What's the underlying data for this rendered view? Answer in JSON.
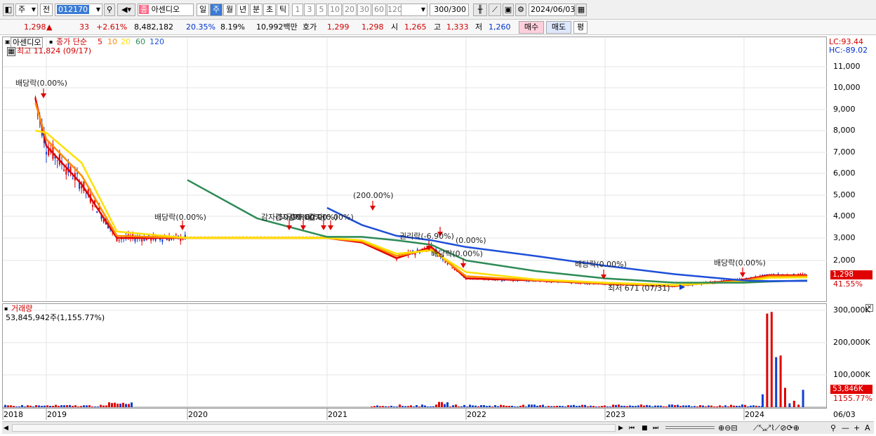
{
  "toolbar": {
    "period_type": "주",
    "prev_label": "전",
    "code": "012170",
    "name_badge": "종",
    "stock_name": "아센디오",
    "tabs": [
      {
        "label": "일",
        "selected": false
      },
      {
        "label": "주",
        "selected": true
      },
      {
        "label": "월",
        "selected": false
      },
      {
        "label": "년",
        "selected": false
      },
      {
        "label": "분",
        "selected": false
      },
      {
        "label": "초",
        "selected": false
      },
      {
        "label": "틱",
        "selected": false
      }
    ],
    "intervals": [
      "1",
      "3",
      "5",
      "10",
      "20",
      "30",
      "60",
      "120"
    ],
    "count": "300",
    "count_total": "/300",
    "date": "2024/06/03"
  },
  "quote": {
    "price": "1,298",
    "change_arrow": "▲",
    "change": "33",
    "change_pct": "+2.61%",
    "volume": "8,482,182",
    "turnover_pct": "20.35%",
    "rate": "8.19%",
    "amount": "10,992백만",
    "ask_label": "호가",
    "ask1": "1,299",
    "ask2": "1,298",
    "open_label": "시",
    "open": "1,265",
    "high_label": "고",
    "high": "1,333",
    "low_label": "저",
    "low": "1,260",
    "buy_label": "매수",
    "sell_label": "매도",
    "eval_label": "평"
  },
  "price_panel": {
    "title": "아센디오",
    "ma_label": "종가 단순",
    "ma_periods": [
      "5",
      "10",
      "20",
      "60",
      "120"
    ],
    "ma_colors": [
      "#e00000",
      "#ff8c00",
      "#ffe000",
      "#2e8b57",
      "#1e4fd8"
    ],
    "max_label": "최고 11,824 (09/17)",
    "min_label": "최저 671 (07/31)",
    "lc": "LC:93.44",
    "hc": "HC:-89.02",
    "y_ticks": [
      "11,000",
      "10,000",
      "9,000",
      "8,000",
      "7,000",
      "6,000",
      "5,000",
      "4,000",
      "3,000",
      "2,000"
    ],
    "current_price_box": "1,298",
    "current_pct": "41.55%",
    "annotations": [
      {
        "text": "배당락(0.00%)"
      },
      {
        "text": "배당락(0.00%)"
      },
      {
        "text": "감자(50.00%)"
      },
      {
        "text": "감자(90.00%)"
      },
      {
        "text": "감자(60.00%)"
      },
      {
        "text": "감자(0.00%)"
      },
      {
        "text": "(200.00%)"
      },
      {
        "text": "권리락(-6.90%)"
      },
      {
        "text": "(0.00%)"
      },
      {
        "text": "배당락(0.00%)"
      },
      {
        "text": "배당락(0.00%)"
      },
      {
        "text": "배당락(0.00%)"
      }
    ]
  },
  "volume_panel": {
    "title": "거래량",
    "value_label": "53,845,942주(1,155.77%)",
    "y_ticks": [
      "300,000K",
      "200,000K",
      "100,000K"
    ],
    "current_box": "53,846K",
    "current_pct": "1155.77%"
  },
  "x_labels": [
    "2018",
    "2019",
    "2020",
    "2021",
    "2022",
    "2023",
    "2024"
  ],
  "x_end_label": "06/03",
  "chart_data": {
    "type": "line",
    "title": "아센디오",
    "ylabel": "",
    "ylim": [
      600,
      11800
    ],
    "x": [
      "2018-10",
      "2019-01",
      "2019-04",
      "2019-07",
      "2020-01",
      "2020-07",
      "2021-01",
      "2021-04",
      "2021-07",
      "2021-10",
      "2022-01",
      "2022-07",
      "2023-01",
      "2023-07",
      "2024-01",
      "2024-03",
      "2024-06"
    ],
    "series": [
      {
        "name": "5",
        "values": [
          9500,
          7300,
          5500,
          3000,
          3000,
          3000,
          3000,
          2800,
          2100,
          2600,
          1150,
          1050,
          900,
          800,
          1100,
          1300,
          1298
        ]
      },
      {
        "name": "10",
        "values": [
          9300,
          7600,
          5900,
          3100,
          3000,
          3000,
          3000,
          2850,
          2200,
          2500,
          1250,
          1070,
          920,
          820,
          1050,
          1250,
          1250
        ]
      },
      {
        "name": "20",
        "values": [
          8000,
          7900,
          6500,
          3300,
          3000,
          3000,
          3000,
          2900,
          2300,
          2450,
          1450,
          1100,
          950,
          850,
          1000,
          1180,
          1200
        ]
      },
      {
        "name": "60",
        "values": [
          null,
          null,
          null,
          null,
          5700,
          3900,
          3050,
          3050,
          2900,
          2700,
          2000,
          1500,
          1150,
          950,
          950,
          1000,
          1050
        ]
      },
      {
        "name": "120",
        "values": [
          null,
          null,
          null,
          null,
          null,
          null,
          4400,
          3600,
          3100,
          2900,
          2600,
          2200,
          1750,
          1350,
          1050,
          1020,
          1030
        ]
      }
    ],
    "volume": {
      "unit": "K",
      "ylim": [
        0,
        310000
      ],
      "recent_weeks": [
        40000,
        290000,
        295000,
        155000,
        160000,
        60000,
        12000,
        20000,
        8000,
        53846
      ]
    }
  }
}
